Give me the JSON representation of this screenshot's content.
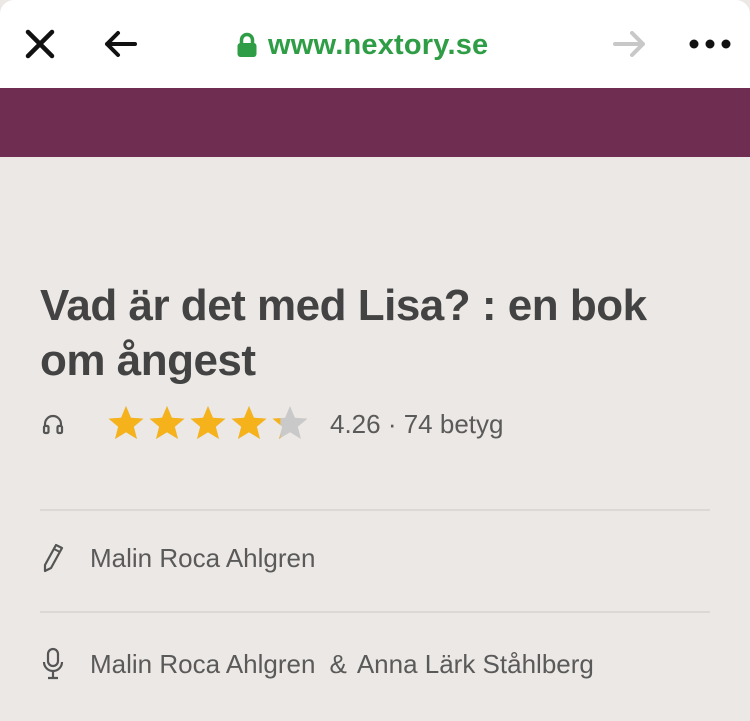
{
  "browser": {
    "url": "www.nextory.se",
    "accent_color": "#2e9d45",
    "icons": [
      "close-icon",
      "back-arrow-icon",
      "lock-icon",
      "forward-arrow-icon",
      "more-icon"
    ]
  },
  "header": {
    "brand_color": "#6e2d51"
  },
  "book": {
    "title": "Vad är det med Lisa? : en bok om ångest",
    "format_icon": "headphones-icon",
    "rating": 4.26,
    "rating_text": "4.26 · 74 betyg",
    "star_color": "#f5b21a"
  },
  "contributors": {
    "author": {
      "icon": "pen-icon",
      "name": "Malin Roca Ahlgren"
    },
    "narrators": {
      "icon": "microphone-icon",
      "first": "Malin Roca Ahlgren",
      "separator": "&",
      "second": "Anna Lärk Ståhlberg"
    }
  }
}
